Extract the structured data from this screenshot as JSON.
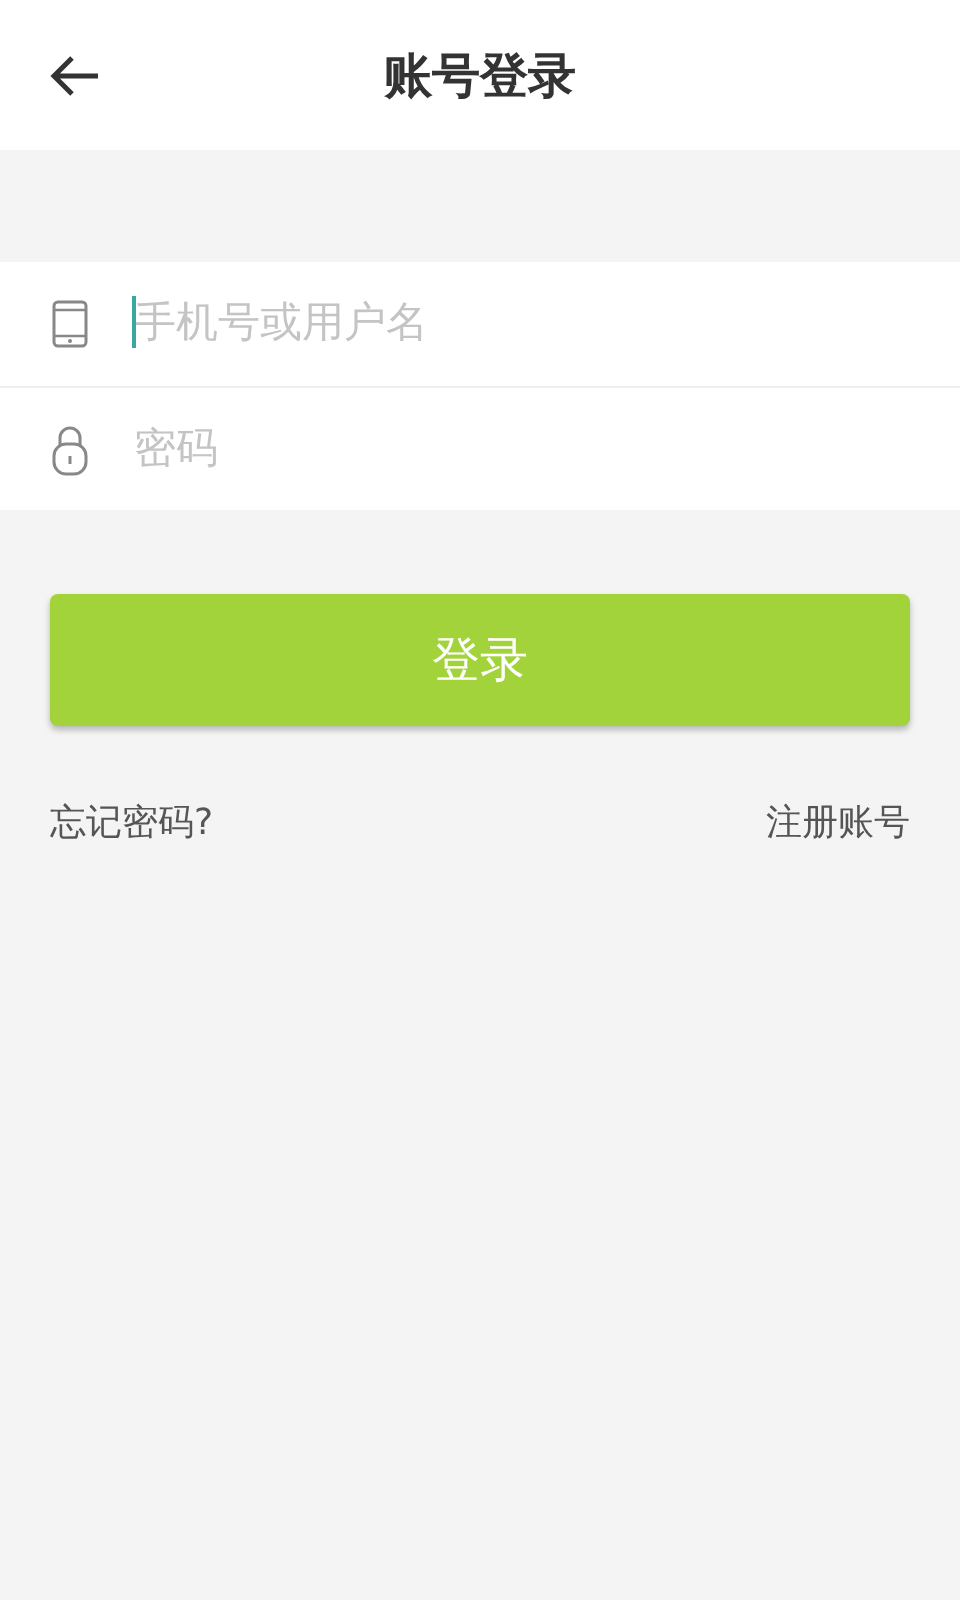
{
  "header": {
    "title": "账号登录"
  },
  "fields": [
    {
      "kind": "phone",
      "placeholder": "手机号或用户名",
      "focused": true
    },
    {
      "kind": "lock",
      "placeholder": "密码",
      "focused": false
    }
  ],
  "login_button": {
    "label": "登录"
  },
  "links": [
    "忘记密码?",
    "注册账号"
  ]
}
